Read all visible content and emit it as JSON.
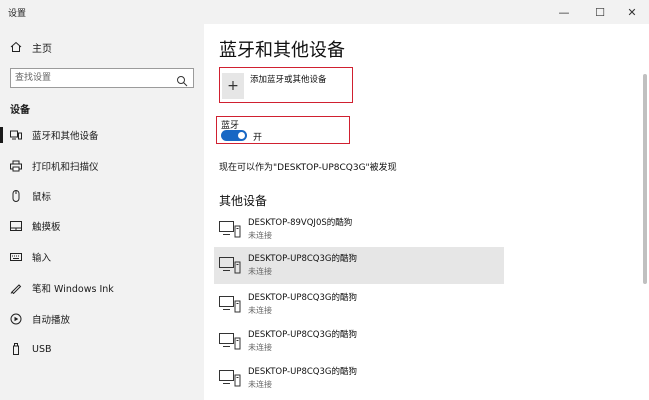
{
  "window": {
    "title": "设置",
    "minimize_glyph": "—",
    "maximize_glyph": "☐",
    "close_glyph": "✕"
  },
  "sidebar": {
    "home_label": "主页",
    "search_placeholder": "查找设置",
    "section_label": "设备",
    "items": [
      {
        "label": "蓝牙和其他设备",
        "icon": "bluetooth-devices-icon",
        "selected": true
      },
      {
        "label": "打印机和扫描仪",
        "icon": "printer-icon"
      },
      {
        "label": "鼠标",
        "icon": "mouse-icon"
      },
      {
        "label": "触摸板",
        "icon": "touchpad-icon"
      },
      {
        "label": "输入",
        "icon": "keyboard-icon"
      },
      {
        "label": "笔和 Windows Ink",
        "icon": "pen-icon"
      },
      {
        "label": "自动播放",
        "icon": "autoplay-icon"
      },
      {
        "label": "USB",
        "icon": "usb-icon"
      }
    ]
  },
  "main": {
    "title": "蓝牙和其他设备",
    "add_device_label": "添加蓝牙或其他设备",
    "bluetooth_label": "蓝牙",
    "bluetooth_state": "开",
    "discoverable_text": "现在可以作为\"DESKTOP-UP8CQ3G\"被发现",
    "other_devices_title": "其他设备",
    "devices": [
      {
        "name": "DESKTOP-89VQJ0S的酷狗",
        "status": "未连接"
      },
      {
        "name": "DESKTOP-UP8CQ3G的酷狗",
        "status": "未连接",
        "highlighted": true
      },
      {
        "name": "DESKTOP-UP8CQ3G的酷狗",
        "status": "未连接"
      },
      {
        "name": "DESKTOP-UP8CQ3G的酷狗",
        "status": "未连接"
      },
      {
        "name": "DESKTOP-UP8CQ3G的酷狗",
        "status": "未连接"
      }
    ]
  },
  "colors": {
    "accent": "#1767c4",
    "highlight_border": "#d02030",
    "sidebar_bg": "#f2f2f2"
  }
}
